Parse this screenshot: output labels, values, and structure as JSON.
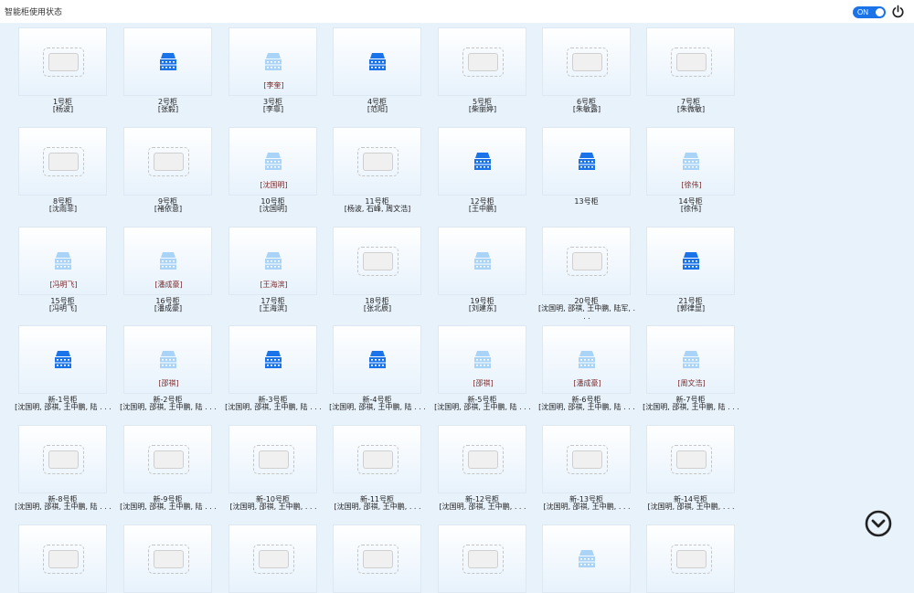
{
  "header": {
    "title": "智能柜使用状态",
    "toggle_label": "ON"
  },
  "colors": {
    "cabinet_active": "#1a73e8",
    "cabinet_faded": "#a9d4f7"
  },
  "icons": {
    "power": "power-icon",
    "scroll": "chevron-down-circle-icon"
  },
  "lockers": [
    {
      "number": "1号柜",
      "users": "[杨波]",
      "state": "empty",
      "occupant": ""
    },
    {
      "number": "2号柜",
      "users": "[张毅]",
      "state": "active",
      "occupant": ""
    },
    {
      "number": "3号柜",
      "users": "[李靠]",
      "state": "reserved",
      "occupant": "[李奎]"
    },
    {
      "number": "4号柜",
      "users": "[范阳]",
      "state": "active",
      "occupant": ""
    },
    {
      "number": "5号柜",
      "users": "[柴丽婷]",
      "state": "empty",
      "occupant": ""
    },
    {
      "number": "6号柜",
      "users": "[朱敏露]",
      "state": "empty",
      "occupant": ""
    },
    {
      "number": "7号柜",
      "users": "[朱微敏]",
      "state": "empty",
      "occupant": ""
    },
    {
      "number": "8号柜",
      "users": "[沈雨菲]",
      "state": "empty",
      "occupant": ""
    },
    {
      "number": "9号柜",
      "users": "[褚依意]",
      "state": "empty",
      "occupant": ""
    },
    {
      "number": "10号柜",
      "users": "[沈国明]",
      "state": "reserved",
      "occupant": "[沈国明]"
    },
    {
      "number": "11号柜",
      "users": "[杨波, 石峰, 周文浩]",
      "state": "empty",
      "occupant": ""
    },
    {
      "number": "12号柜",
      "users": "[王中鹏]",
      "state": "active",
      "occupant": ""
    },
    {
      "number": "13号柜",
      "users": "",
      "state": "active",
      "occupant": ""
    },
    {
      "number": "14号柜",
      "users": "[徐伟]",
      "state": "reserved",
      "occupant": "[徐伟]"
    },
    {
      "number": "15号柜",
      "users": "[冯明飞]",
      "state": "reserved",
      "occupant": "[冯明飞]"
    },
    {
      "number": "16号柜",
      "users": "[潘成豪]",
      "state": "reserved",
      "occupant": "[潘成豪]"
    },
    {
      "number": "17号柜",
      "users": "[王海滨]",
      "state": "reserved",
      "occupant": "[王海滨]"
    },
    {
      "number": "18号柜",
      "users": "[张北辰]",
      "state": "empty",
      "occupant": ""
    },
    {
      "number": "19号柜",
      "users": "[刘建东]",
      "state": "reserved",
      "occupant": ""
    },
    {
      "number": "20号柜",
      "users": "[沈国明, 邵祺, 王中鹏, 陆军, . . .",
      "state": "empty",
      "occupant": ""
    },
    {
      "number": "21号柜",
      "users": "[郭律显]",
      "state": "active",
      "occupant": ""
    },
    {
      "number": "新-1号柜",
      "users": "[沈国明, 邵祺, 王中鹏, 陆 . . .",
      "state": "active",
      "occupant": ""
    },
    {
      "number": "新-2号柜",
      "users": "[沈国明, 邵祺, 王中鹏, 陆 . . .",
      "state": "reserved",
      "occupant": "[邵祺]"
    },
    {
      "number": "新-3号柜",
      "users": "[沈国明, 邵祺, 王中鹏, 陆 . . .",
      "state": "active",
      "occupant": ""
    },
    {
      "number": "新-4号柜",
      "users": "[沈国明, 邵祺, 王中鹏, 陆 . . .",
      "state": "active",
      "occupant": ""
    },
    {
      "number": "新-5号柜",
      "users": "[沈国明, 邵祺, 王中鹏, 陆 . . .",
      "state": "reserved",
      "occupant": "[邵祺]"
    },
    {
      "number": "新-6号柜",
      "users": "[沈国明, 邵祺, 王中鹏, 陆 . . .",
      "state": "reserved",
      "occupant": "[潘成豪]"
    },
    {
      "number": "新-7号柜",
      "users": "[沈国明, 邵祺, 王中鹏, 陆 . . .",
      "state": "reserved",
      "occupant": "[周文浩]"
    },
    {
      "number": "新-8号柜",
      "users": "[沈国明, 邵祺, 王中鹏, 陆 . . .",
      "state": "empty",
      "occupant": ""
    },
    {
      "number": "新-9号柜",
      "users": "[沈国明, 邵祺, 王中鹏, 陆 . . .",
      "state": "empty",
      "occupant": ""
    },
    {
      "number": "新-10号柜",
      "users": "[沈国明, 邵祺, 王中鹏, . . .",
      "state": "empty",
      "occupant": ""
    },
    {
      "number": "新-11号柜",
      "users": "[沈国明, 邵祺, 王中鹏, . . .",
      "state": "empty",
      "occupant": ""
    },
    {
      "number": "新-12号柜",
      "users": "[沈国明, 邵祺, 王中鹏, . . .",
      "state": "empty",
      "occupant": ""
    },
    {
      "number": "新-13号柜",
      "users": "[沈国明, 邵祺, 王中鹏, . . .",
      "state": "empty",
      "occupant": ""
    },
    {
      "number": "新-14号柜",
      "users": "[沈国明, 邵祺, 王中鹏, . . .",
      "state": "empty",
      "occupant": ""
    },
    {
      "number": "",
      "users": "",
      "state": "empty",
      "occupant": ""
    },
    {
      "number": "",
      "users": "",
      "state": "empty",
      "occupant": ""
    },
    {
      "number": "",
      "users": "",
      "state": "empty",
      "occupant": ""
    },
    {
      "number": "",
      "users": "",
      "state": "empty",
      "occupant": ""
    },
    {
      "number": "",
      "users": "",
      "state": "empty",
      "occupant": ""
    },
    {
      "number": "",
      "users": "",
      "state": "reserved",
      "occupant": ""
    },
    {
      "number": "",
      "users": "",
      "state": "empty",
      "occupant": ""
    }
  ]
}
